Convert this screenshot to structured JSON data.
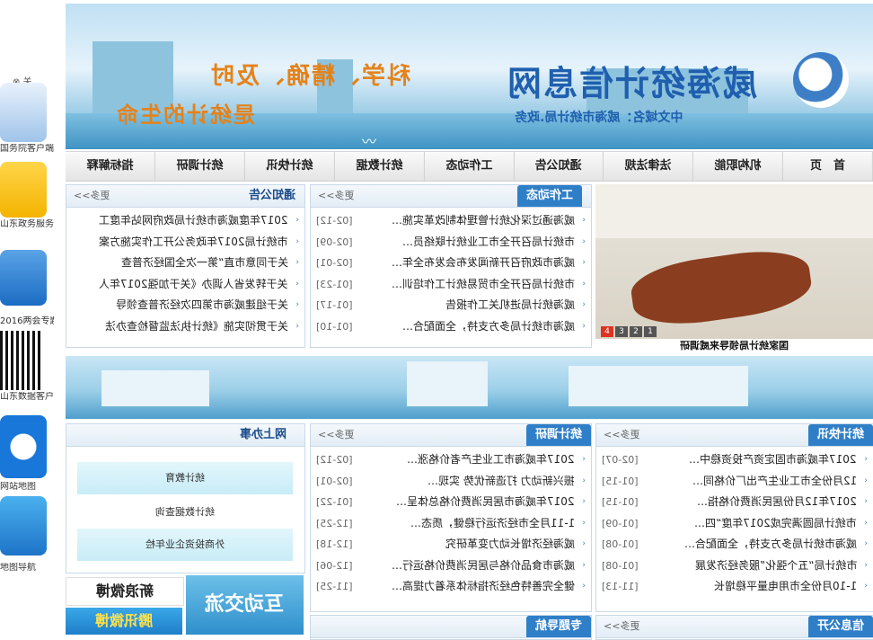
{
  "left": {
    "close_label": "⊗ 关",
    "captions": [
      "国务院客户端",
      "山东政务服务门户",
      "2016两会专题",
      "山东数据客户端",
      "网站地图",
      "地图导航"
    ]
  },
  "banner": {
    "slogan_line1": "科学、精确、及时",
    "slogan_line2": "是统计的生命",
    "site_name": "威海统计信息网",
    "domain_label": "中文域名：威海市统计局.政务"
  },
  "nav": [
    "首　页",
    "机构职能",
    "法律法规",
    "通知公告",
    "工作动态",
    "统计数据",
    "统计快讯",
    "统计调研",
    "指标解释"
  ],
  "notice": {
    "title": "通知公告",
    "more": "更多>>",
    "items": [
      "2017年度威海市统计局政府网站年度工",
      "市统计局2017年政务公开工作实施方案",
      "关于同意市直“第一次全国经济普查",
      "关于转发省人调办《关于加强2017年人",
      "关于组建威海市第四次经济普查领导",
      "关于贯彻实施《统计执法监督检查办法"
    ]
  },
  "work": {
    "title": "工作动态",
    "more": "更多>>",
    "items": [
      {
        "t": "威海通过深化统计管理体制改革实施…",
        "d": "[02-12]"
      },
      {
        "t": "市统计局召开全市工业统计联络员…",
        "d": "[02-09]"
      },
      {
        "t": "威海市政府召开新闻发布会发布全年…",
        "d": "[02-01]"
      },
      {
        "t": "市统计局召开全市贸易统计工作培训…",
        "d": "[01-23]"
      },
      {
        "t": "威海统计局进机关工作报告",
        "d": "[01-17]"
      },
      {
        "t": "威海市统计局多方支持，全面配合…",
        "d": "[01-10]"
      }
    ]
  },
  "photo": {
    "caption": "国家统计局领导来威调研",
    "pager": [
      "1",
      "2",
      "3",
      "4"
    ]
  },
  "online": {
    "title": "网上办事",
    "buttons": [
      "统计教育",
      "统计数据查询",
      "外商投资企业年检"
    ]
  },
  "research": {
    "title": "统计调研",
    "more": "更多>>",
    "items": [
      {
        "t": "2017年威海市工业生产者价格涨…",
        "d": "[02-12]"
      },
      {
        "t": "振兴新动力 打造新优势 实现…",
        "d": "[02-01]"
      },
      {
        "t": "2017年威海市居民消费价格总体呈…",
        "d": "[01-22]"
      },
      {
        "t": "1-11月全市经济运行稳健，质态…",
        "d": "[12-25]"
      },
      {
        "t": "威海经济增长动力变革研究",
        "d": "[12-18]"
      },
      {
        "t": "威海市食品价格与居民消费价格运行…",
        "d": "[12-06]"
      },
      {
        "t": "健全完善特色经济指标体系着力提高…",
        "d": "[11-25]"
      }
    ]
  },
  "express": {
    "title": "统计快讯",
    "more": "更多>>",
    "items": [
      {
        "t": "2017年威海市固定资产投资稳中…",
        "d": "[02-07]"
      },
      {
        "t": "12月份全市工业生产出厂价格同…",
        "d": "[01-15]"
      },
      {
        "t": "2017年12月份居民消费价格指…",
        "d": "[01-15]"
      },
      {
        "t": "市统计局圆满完成2017年度“四…",
        "d": "[01-09]"
      },
      {
        "t": "威海市统计局多方支持，全面配合…",
        "d": "[01-08]"
      },
      {
        "t": "市统计局“五个强化”服务经济发展",
        "d": "[01-08]"
      },
      {
        "t": "1-10月份全市用电量平稳增长",
        "d": "[11-13]"
      }
    ]
  },
  "weibo": {
    "sina": "新浪微博",
    "tencent": "腾讯微博",
    "interact": "互动交流"
  },
  "bottom": {
    "topics": "专题导航",
    "info": "信息公开",
    "more": "更多>>"
  }
}
